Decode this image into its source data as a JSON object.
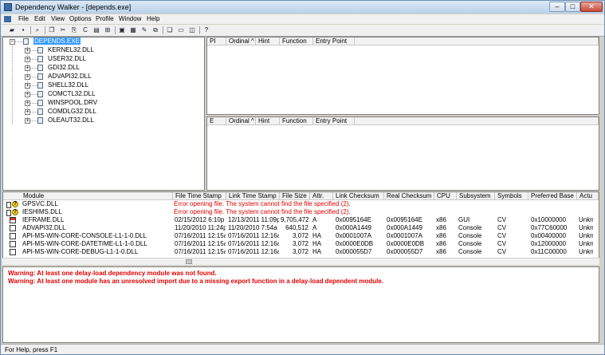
{
  "window": {
    "title": "Dependency Walker - [depends.exe]"
  },
  "menu": [
    "File",
    "Edit",
    "View",
    "Options",
    "Profile",
    "Window",
    "Help"
  ],
  "tree": {
    "root": "DEPENDS.EXE",
    "children": [
      "KERNEL32.DLL",
      "USER32.DLL",
      "GDI32.DLL",
      "ADVAPI32.DLL",
      "SHELL32.DLL",
      "COMCTL32.DLL",
      "WINSPOOL.DRV",
      "COMDLG32.DLL",
      "OLEAUT32.DLL"
    ]
  },
  "import_pane": {
    "columns": [
      "PI",
      "Ordinal ^",
      "Hint",
      "Function",
      "Entry Point"
    ]
  },
  "export_pane": {
    "columns": [
      "E",
      "Ordinal ^",
      "Hint",
      "Function",
      "Entry Point"
    ]
  },
  "modules": {
    "columns": [
      "Module",
      "File Time Stamp",
      "Link Time Stamp",
      "File Size",
      "Attr.",
      "Link Checksum",
      "Real Checksum",
      "CPU",
      "Subsystem",
      "Symbols",
      "Preferred Base",
      "Actu"
    ],
    "rows": [
      {
        "icon": "warning-missing",
        "module": "GPSVC.DLL",
        "error": "Error opening file. The system cannot find the file specified (2)."
      },
      {
        "icon": "warning-missing",
        "module": "IESHIMS.DLL",
        "error": "Error opening file. The system cannot find the file specified (2)."
      },
      {
        "icon": "module-flagged",
        "module": "IEFRAME.DLL",
        "cells": [
          "02/15/2012  6:10p",
          "12/13/2011 11:09p",
          "9,705,472",
          "A",
          "0x0095164E",
          "0x0095164E",
          "x86",
          "GUI",
          "CV",
          "0x10000000",
          "Unkn"
        ]
      },
      {
        "icon": "module",
        "module": "ADVAPI32.DLL",
        "cells": [
          "11/20/2010 11:24p",
          "11/20/2010  7:54a",
          "640,512",
          "A",
          "0x000A1449",
          "0x000A1449",
          "x86",
          "Console",
          "CV",
          "0x77C60000",
          "Unkn"
        ]
      },
      {
        "icon": "module",
        "module": "API-MS-WIN-CORE-CONSOLE-L1-1-0.DLL",
        "cells": [
          "07/16/2011 12:15a",
          "07/16/2011 12:16a",
          "3,072",
          "HA",
          "0x0001007A",
          "0x0001007A",
          "x86",
          "Console",
          "CV",
          "0x00400000",
          "Unkn"
        ]
      },
      {
        "icon": "module",
        "module": "API-MS-WIN-CORE-DATETIME-L1-1-0.DLL",
        "cells": [
          "07/16/2011 12:15a",
          "07/16/2011 12:16a",
          "3,072",
          "HA",
          "0x0000E0DB",
          "0x0000E0DB",
          "x86",
          "Console",
          "CV",
          "0x12000000",
          "Unkn"
        ]
      },
      {
        "icon": "module",
        "module": "API-MS-WIN-CORE-DEBUG-L1-1-0.DLL",
        "cells": [
          "07/16/2011 12:15a",
          "07/16/2011 12:16a",
          "3,072",
          "HA",
          "0x000055D7",
          "0x000055D7",
          "x86",
          "Console",
          "CV",
          "0x11C00000",
          "Unkn"
        ]
      }
    ]
  },
  "warnings": [
    "Warning: At least one delay-load dependency module was not found.",
    "Warning: At least one module has an unresolved import due to a missing export function in a delay-load dependent module."
  ],
  "status": "For Help, press F1",
  "colors": {
    "selection": "#3399ff",
    "error_text": "#e00000",
    "warning_icon": "#f5d000"
  }
}
